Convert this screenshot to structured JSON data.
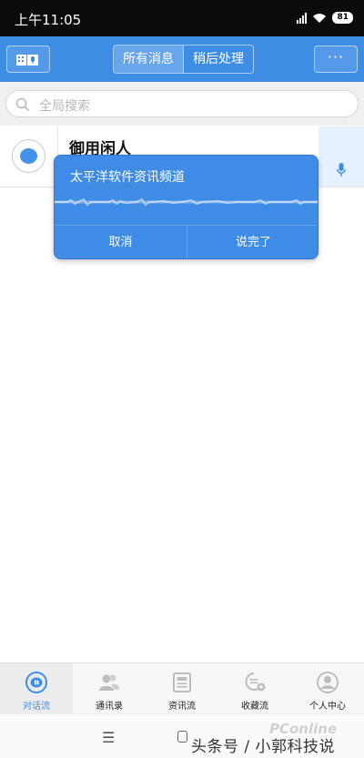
{
  "status_bar": {
    "time": "上午11:05",
    "battery": "81"
  },
  "header": {
    "tabs": [
      {
        "label": "所有消息",
        "active": true
      },
      {
        "label": "稍后处理",
        "active": false
      }
    ],
    "more_label": "···"
  },
  "search": {
    "placeholder": "全局搜索"
  },
  "conversation": {
    "name": "御用闲人"
  },
  "voice_dialog": {
    "title": "太平洋软件资讯频道",
    "cancel_label": "取消",
    "done_label": "说完了"
  },
  "bottom_tabs": [
    {
      "label": "对话流",
      "icon": "chat-bubble-icon",
      "active": true
    },
    {
      "label": "通讯录",
      "icon": "contacts-icon",
      "active": false
    },
    {
      "label": "资讯流",
      "icon": "news-icon",
      "active": false
    },
    {
      "label": "收藏流",
      "icon": "favorites-icon",
      "active": false
    },
    {
      "label": "个人中心",
      "icon": "profile-icon",
      "active": false
    }
  ],
  "watermark": {
    "text": "头条号 / 小郭科技说",
    "site": "PConline"
  },
  "colors": {
    "primary": "#3d8de5",
    "dialog": "#3f8ce6",
    "accent_light": "#e5f1ff"
  }
}
